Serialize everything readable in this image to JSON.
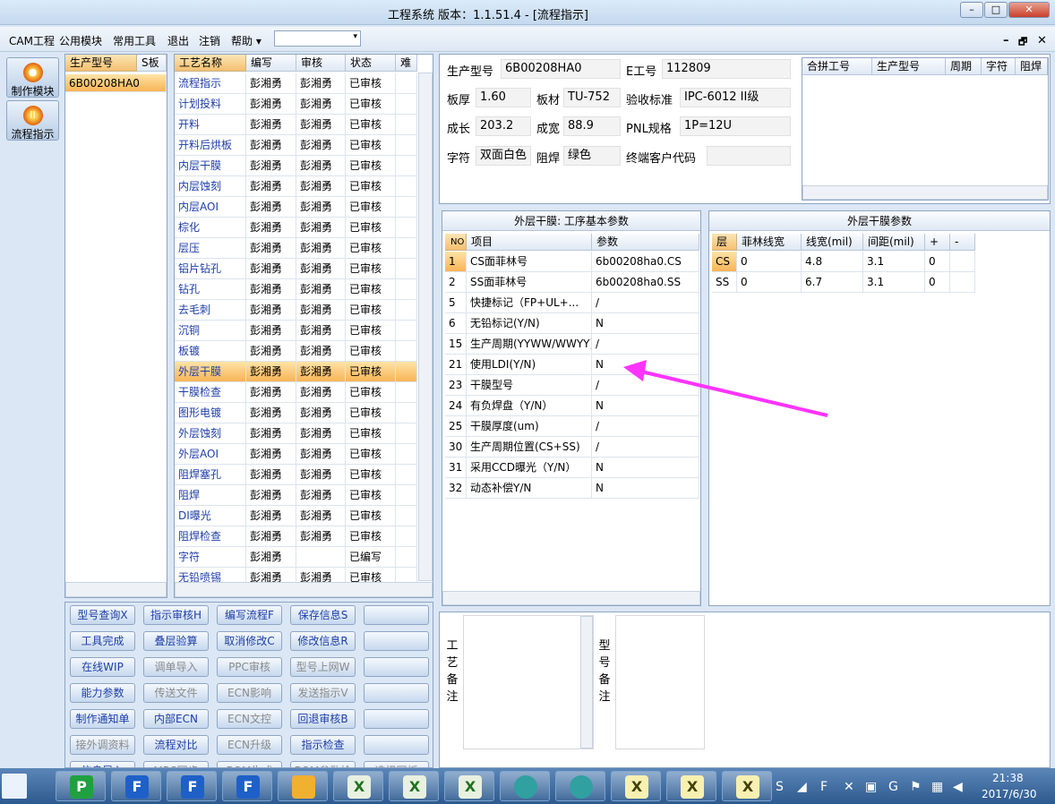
{
  "window": {
    "title": "工程系统   版本：1.1.51.4 - [流程指示]",
    "min": "–",
    "max": "□",
    "close": "✕"
  },
  "menu": {
    "items": [
      "CAM工程",
      "公用模块",
      "常用工具",
      "退出",
      "注销",
      "帮助 ▾"
    ],
    "combo_arrow": "▾",
    "mdi": [
      "–",
      "🗗",
      "✕"
    ]
  },
  "nav": [
    {
      "label": "制作模块",
      "icon": "fire-icon",
      "glyph": "●"
    },
    {
      "label": "流程指示",
      "icon": "pause-icon",
      "glyph": "II"
    }
  ],
  "model_list": {
    "headers": [
      "生产型号",
      "S板"
    ],
    "rows": [
      "6B00208HA0"
    ]
  },
  "process": {
    "headers": [
      "工艺名称",
      "编写",
      "审核",
      "状态",
      "难"
    ],
    "rows": [
      [
        "流程指示",
        "彭湘勇",
        "彭湘勇",
        "已审核"
      ],
      [
        "计划投料",
        "彭湘勇",
        "彭湘勇",
        "已审核"
      ],
      [
        "开料",
        "彭湘勇",
        "彭湘勇",
        "已审核"
      ],
      [
        "开料后烘板",
        "彭湘勇",
        "彭湘勇",
        "已审核"
      ],
      [
        "内层干膜",
        "彭湘勇",
        "彭湘勇",
        "已审核"
      ],
      [
        "内层蚀刻",
        "彭湘勇",
        "彭湘勇",
        "已审核"
      ],
      [
        "内层AOI",
        "彭湘勇",
        "彭湘勇",
        "已审核"
      ],
      [
        "棕化",
        "彭湘勇",
        "彭湘勇",
        "已审核"
      ],
      [
        "层压",
        "彭湘勇",
        "彭湘勇",
        "已审核"
      ],
      [
        "铝片钻孔",
        "彭湘勇",
        "彭湘勇",
        "已审核"
      ],
      [
        "钻孔",
        "彭湘勇",
        "彭湘勇",
        "已审核"
      ],
      [
        "去毛刺",
        "彭湘勇",
        "彭湘勇",
        "已审核"
      ],
      [
        "沉铜",
        "彭湘勇",
        "彭湘勇",
        "已审核"
      ],
      [
        "板镀",
        "彭湘勇",
        "彭湘勇",
        "已审核"
      ],
      [
        "外层干膜",
        "彭湘勇",
        "彭湘勇",
        "已审核"
      ],
      [
        "干膜检查",
        "彭湘勇",
        "彭湘勇",
        "已审核"
      ],
      [
        "图形电镀",
        "彭湘勇",
        "彭湘勇",
        "已审核"
      ],
      [
        "外层蚀刻",
        "彭湘勇",
        "彭湘勇",
        "已审核"
      ],
      [
        "外层AOI",
        "彭湘勇",
        "彭湘勇",
        "已审核"
      ],
      [
        "阻焊塞孔",
        "彭湘勇",
        "彭湘勇",
        "已审核"
      ],
      [
        "阻焊",
        "彭湘勇",
        "彭湘勇",
        "已审核"
      ],
      [
        "DI曝光",
        "彭湘勇",
        "彭湘勇",
        "已审核"
      ],
      [
        "阻焊检查",
        "彭湘勇",
        "彭湘勇",
        "已审核"
      ],
      [
        "字符",
        "彭湘勇",
        "",
        "已编写"
      ],
      [
        "无铅喷锡",
        "彭湘勇",
        "彭湘勇",
        "已审核"
      ]
    ],
    "selected": 14
  },
  "info": {
    "prod_model": {
      "label": "生产型号",
      "value": "6B00208HA0"
    },
    "e_no": {
      "label": "E工号",
      "value": "112809"
    },
    "thickness": {
      "label": "板厚",
      "value": "1.60"
    },
    "material": {
      "label": "板材",
      "value": "TU-752"
    },
    "standard": {
      "label": "验收标准",
      "value": "IPC-6012 II级"
    },
    "length": {
      "label": "成长",
      "value": "203.2"
    },
    "width": {
      "label": "成宽",
      "value": "88.9"
    },
    "pnl": {
      "label": "PNL规格",
      "value": "1P=12U"
    },
    "silk": {
      "label": "字符",
      "value": "双面白色"
    },
    "mask": {
      "label": "阻焊",
      "value": "绿色"
    },
    "customer": {
      "label": "终端客户代码",
      "value": ""
    }
  },
  "merge": {
    "headers": [
      "合拼工号",
      "生产型号",
      "周期",
      "字符",
      "阻焊"
    ]
  },
  "basic": {
    "title": "外层干膜: 工序基本参数",
    "headers": [
      "NO",
      "项目",
      "参数"
    ],
    "rows": [
      [
        "1",
        "CS面菲林号",
        "6b00208ha0.CS"
      ],
      [
        "2",
        "SS面菲林号",
        "6b00208ha0.SS"
      ],
      [
        "5",
        "快捷标记（FP+UL+...",
        "/"
      ],
      [
        "6",
        "无铅标记(Y/N)",
        "N"
      ],
      [
        "15",
        "生产周期(YYWW/WWYY)",
        "/"
      ],
      [
        "21",
        "使用LDI(Y/N)",
        "N"
      ],
      [
        "23",
        "干膜型号",
        "/"
      ],
      [
        "24",
        "有负焊盘（Y/N）",
        "N"
      ],
      [
        "25",
        "干膜厚度(um)",
        "/"
      ],
      [
        "30",
        "生产周期位置(CS+SS)",
        "/"
      ],
      [
        "31",
        "采用CCD曝光（Y/N）",
        "N"
      ],
      [
        "32",
        "动态补偿Y/N",
        "N"
      ]
    ]
  },
  "film": {
    "title": "外层干膜参数",
    "headers": [
      "层",
      "菲林线宽",
      "线宽(mil)",
      "间距(mil)",
      "+",
      "-"
    ],
    "rows": [
      [
        "CS",
        "0",
        "4.8",
        "3.1",
        "0"
      ],
      [
        "SS",
        "0",
        "6.7",
        "3.1",
        "0"
      ]
    ]
  },
  "remarks": {
    "process_label": "工艺备注",
    "model_label": "型号备注"
  },
  "buttons": [
    [
      "型号查询X",
      "指示审核H",
      "编写流程F",
      "保存信息S",
      ""
    ],
    [
      "工具完成",
      "叠层验算",
      "取消修改C",
      "修改信息R",
      ""
    ],
    [
      "在线WIP",
      "调单导入",
      "PPC审核",
      "型号上网W",
      ""
    ],
    [
      "能力参数",
      "传送文件",
      "ECN影响",
      "发送指示V",
      ""
    ],
    [
      "制作通知单",
      "内部ECN",
      "ECN文控",
      "回退审核B",
      ""
    ],
    [
      "接外调资料",
      "流程对比",
      "ECN升级",
      "指示检查",
      ""
    ],
    [
      "信息导入",
      "MRS同步",
      "BOM生成",
      "BOM参数检查",
      "选择同板"
    ]
  ],
  "disabled_buttons": [
    "调单导入",
    "PPC审核",
    "型号上网W",
    "传送文件",
    "ECN影响",
    "发送指示V",
    "ECN文控",
    "接外调资料",
    "ECN升级",
    "MRS同步",
    "BOM生成",
    "BOM参数检查",
    "选择同板"
  ],
  "taskbar": {
    "time": "21:38",
    "date": "2017/6/30"
  },
  "colors": {
    "accent": "#f4c070",
    "arrow": "#ff33ff",
    "link": "#1e3ea8"
  }
}
